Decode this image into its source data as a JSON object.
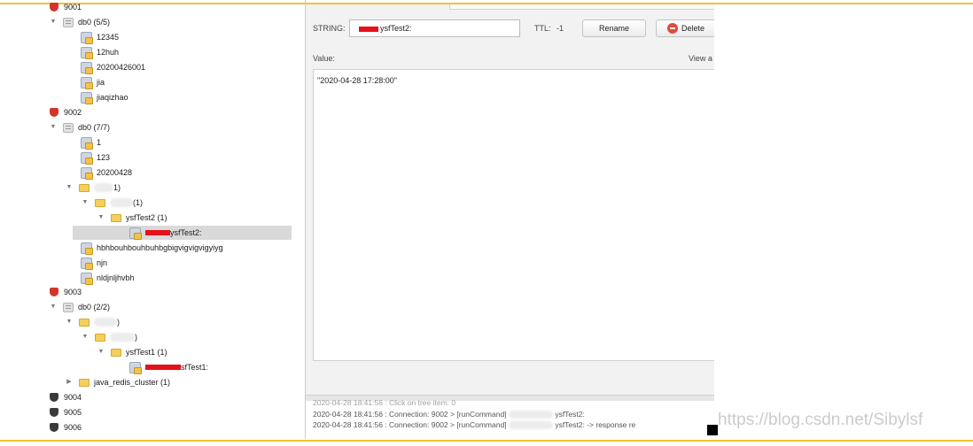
{
  "tree": {
    "rows": [
      {
        "label": "9001",
        "icon": "redis-server-icon"
      },
      {
        "label": "db0 (5/5)",
        "icon": "database-icon",
        "expanded": true
      },
      {
        "label": "12345",
        "icon": "key-icon"
      },
      {
        "label": "12huh",
        "icon": "key-icon"
      },
      {
        "label": "20200426001",
        "icon": "key-icon"
      },
      {
        "label": "jia",
        "icon": "key-icon"
      },
      {
        "label": "jiaqizhao",
        "icon": "key-icon"
      },
      {
        "label": "9002",
        "icon": "redis-server-icon"
      },
      {
        "label": "db0 (7/7)",
        "icon": "database-icon",
        "expanded": true
      },
      {
        "label": "1",
        "icon": "key-icon"
      },
      {
        "label": "123",
        "icon": "key-icon"
      },
      {
        "label": "20200428",
        "icon": "key-icon"
      },
      {
        "label": "1)",
        "icon": "folder-icon",
        "expanded": true
      },
      {
        "label": "(1)",
        "icon": "folder-icon",
        "expanded": true
      },
      {
        "label": "ysfTest2 (1)",
        "icon": "folder-icon",
        "expanded": true
      },
      {
        "label": "ysfTest2:",
        "icon": "key-icon",
        "selected": true
      },
      {
        "label": "hbhbouhbouhbuhbgbigvigvigvigyiyg",
        "icon": "key-icon"
      },
      {
        "label": "njn",
        "icon": "key-icon"
      },
      {
        "label": "nldjnljhvbh",
        "icon": "key-icon"
      },
      {
        "label": "9003",
        "icon": "redis-server-icon"
      },
      {
        "label": "db0 (2/2)",
        "icon": "database-icon",
        "expanded": true
      },
      {
        "label": ")",
        "icon": "folder-icon",
        "expanded": true
      },
      {
        "label": ")",
        "icon": "folder-icon",
        "expanded": true
      },
      {
        "label": "ysfTest1 (1)",
        "icon": "folder-icon",
        "expanded": true
      },
      {
        "label": "sfTest1:",
        "icon": "key-icon"
      },
      {
        "label": "java_redis_cluster (1)",
        "icon": "folder-icon",
        "expanded": false
      },
      {
        "label": "9004",
        "icon": "redis-server-dark-icon"
      },
      {
        "label": "9005",
        "icon": "redis-server-dark-icon"
      },
      {
        "label": "9006",
        "icon": "redis-server-dark-icon"
      }
    ]
  },
  "detail": {
    "type_label": "STRING:",
    "key_value": "ysfTest2:",
    "ttl_label": "TTL:",
    "ttl_value": "-1",
    "rename_label": "Rename",
    "delete_label": "Delete",
    "value_label": "Value:",
    "view_label": "View a",
    "value_text": "\"2020-04-28 17:28:00\""
  },
  "log": {
    "clipped_line": "2020-04-28 18:41:56 : Click on tree item: 0",
    "line1_prefix": "2020-04-28 18:41:56 : Connection: 9002 > [runCommand]",
    "line1_suffix": "ysfTest2:",
    "line2_prefix": "2020-04-28 18:41:56 : Connection: 9002 > [runCommand]",
    "line2_suffix": "ysfTest2: -> response re"
  },
  "watermark": "https://blog.csdn.net/Sibylsf",
  "colors": {
    "frame_accent": "#f2c230",
    "server_red": "#d3342a",
    "selection": "#d9d9d9",
    "redaction": "#e4111a",
    "delete_icon": "#e24a3b"
  }
}
